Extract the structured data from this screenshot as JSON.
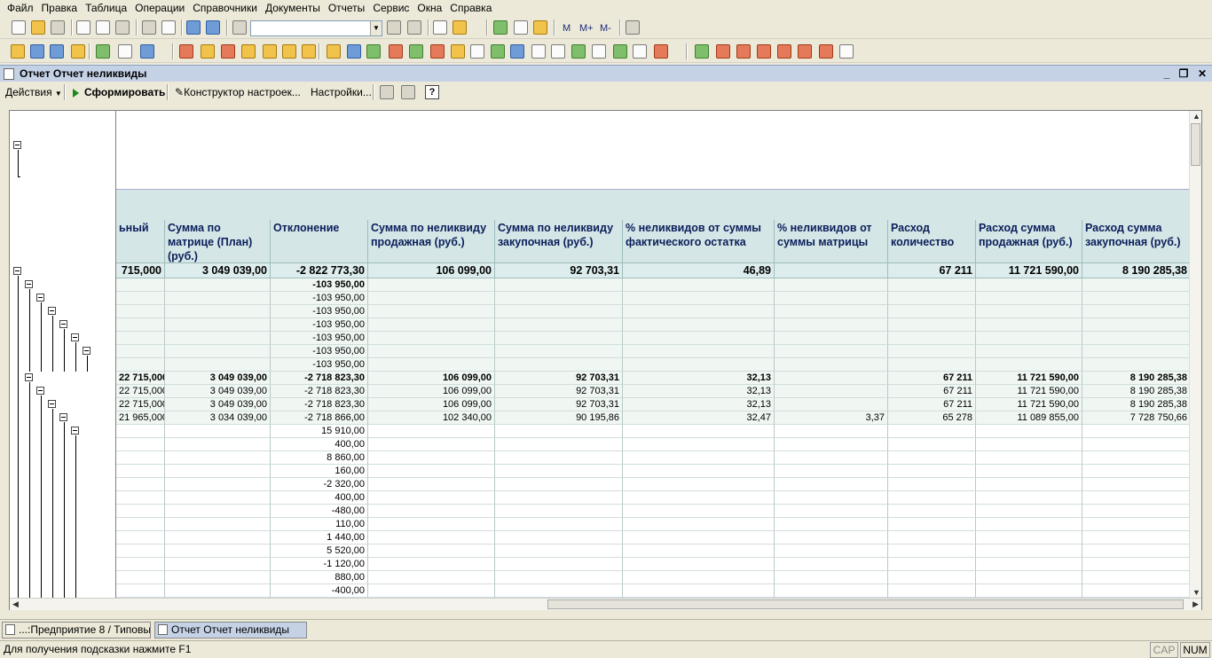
{
  "menu": [
    "Файл",
    "Правка",
    "Таблица",
    "Операции",
    "Справочники",
    "Документы",
    "Отчеты",
    "Сервис",
    "Окна",
    "Справка"
  ],
  "toolbar": {
    "search_value": "",
    "m_label": "M",
    "mplus_label": "M+",
    "mminus_label": "M-"
  },
  "window": {
    "title": "Отчет  Отчет неликвиды"
  },
  "actions": {
    "actions_label": "Действия",
    "form_label": "Сформировать",
    "constructor_label": "Конструктор настроек...",
    "settings_label": "Настройки...",
    "help_label": "?"
  },
  "table": {
    "headers": [
      "ьный",
      "Сумма по матрице (План) (руб.)",
      "Отклонение",
      "Сумма по неликвиду продажная (руб.)",
      "Сумма по неликвиду закупочная (руб.)",
      "% неликвидов от суммы фактического остатка",
      "% неликвидов от суммы матрицы",
      "Расход количество",
      "Расход сумма продажная (руб.)",
      "Расход сумма закупочная (руб.)"
    ],
    "totals": [
      "715,000",
      "3 049 039,00",
      "-2 822 773,30",
      "106 099,00",
      "92 703,31",
      "46,89",
      "",
      "67 211",
      "11 721 590,00",
      "8 190 285,38"
    ],
    "rows": [
      {
        "bold": true,
        "cells": [
          "",
          "",
          "-103 950,00",
          "",
          "",
          "",
          "",
          "",
          "",
          ""
        ]
      },
      {
        "cells": [
          "",
          "",
          "-103 950,00",
          "",
          "",
          "",
          "",
          "",
          "",
          ""
        ]
      },
      {
        "cells": [
          "",
          "",
          "-103 950,00",
          "",
          "",
          "",
          "",
          "",
          "",
          ""
        ]
      },
      {
        "cells": [
          "",
          "",
          "-103 950,00",
          "",
          "",
          "",
          "",
          "",
          "",
          ""
        ]
      },
      {
        "cells": [
          "",
          "",
          "-103 950,00",
          "",
          "",
          "",
          "",
          "",
          "",
          ""
        ]
      },
      {
        "cells": [
          "",
          "",
          "-103 950,00",
          "",
          "",
          "",
          "",
          "",
          "",
          ""
        ]
      },
      {
        "cells": [
          "",
          "",
          "-103 950,00",
          "",
          "",
          "",
          "",
          "",
          "",
          ""
        ]
      },
      {
        "bold": true,
        "cells": [
          "22 715,000",
          "3 049 039,00",
          "-2 718 823,30",
          "106 099,00",
          "92 703,31",
          "32,13",
          "",
          "67 211",
          "11 721 590,00",
          "8 190 285,38"
        ]
      },
      {
        "cells": [
          "22 715,000",
          "3 049 039,00",
          "-2 718 823,30",
          "106 099,00",
          "92 703,31",
          "32,13",
          "",
          "67 211",
          "11 721 590,00",
          "8 190 285,38"
        ]
      },
      {
        "cells": [
          "22 715,000",
          "3 049 039,00",
          "-2 718 823,30",
          "106 099,00",
          "92 703,31",
          "32,13",
          "",
          "67 211",
          "11 721 590,00",
          "8 190 285,38"
        ]
      },
      {
        "cells": [
          "21 965,000",
          "3 034 039,00",
          "-2 718 866,00",
          "102 340,00",
          "90 195,86",
          "32,47",
          "3,37",
          "65 278",
          "11 089 855,00",
          "7 728 750,66"
        ]
      },
      {
        "cells": [
          "",
          "",
          "15 910,00",
          "",
          "",
          "",
          "",
          "",
          "",
          ""
        ]
      },
      {
        "cells": [
          "",
          "",
          "400,00",
          "",
          "",
          "",
          "",
          "",
          "",
          ""
        ]
      },
      {
        "cells": [
          "",
          "",
          "8 860,00",
          "",
          "",
          "",
          "",
          "",
          "",
          ""
        ]
      },
      {
        "cells": [
          "",
          "",
          "160,00",
          "",
          "",
          "",
          "",
          "",
          "",
          ""
        ]
      },
      {
        "cells": [
          "",
          "",
          "-2 320,00",
          "",
          "",
          "",
          "",
          "",
          "",
          ""
        ]
      },
      {
        "cells": [
          "",
          "",
          "400,00",
          "",
          "",
          "",
          "",
          "",
          "",
          ""
        ]
      },
      {
        "cells": [
          "",
          "",
          "-480,00",
          "",
          "",
          "",
          "",
          "",
          "",
          ""
        ]
      },
      {
        "cells": [
          "",
          "",
          "110,00",
          "",
          "",
          "",
          "",
          "",
          "",
          ""
        ]
      },
      {
        "cells": [
          "",
          "",
          "1 440,00",
          "",
          "",
          "",
          "",
          "",
          "",
          ""
        ]
      },
      {
        "cells": [
          "",
          "",
          "5 520,00",
          "",
          "",
          "",
          "",
          "",
          "",
          ""
        ]
      },
      {
        "cells": [
          "",
          "",
          "-1 120,00",
          "",
          "",
          "",
          "",
          "",
          "",
          ""
        ]
      },
      {
        "cells": [
          "",
          "",
          "880,00",
          "",
          "",
          "",
          "",
          "",
          "",
          ""
        ]
      },
      {
        "cells": [
          "",
          "",
          "-400,00",
          "",
          "",
          "",
          "",
          "",
          "",
          ""
        ]
      }
    ]
  },
  "taskbar": {
    "task1": "...:Предприятие 8 / Типовы...",
    "task2": "Отчет  Отчет неликвиды"
  },
  "status": {
    "hint": "Для получения подсказки нажмите F1",
    "cap": "CAP",
    "num": "NUM"
  }
}
